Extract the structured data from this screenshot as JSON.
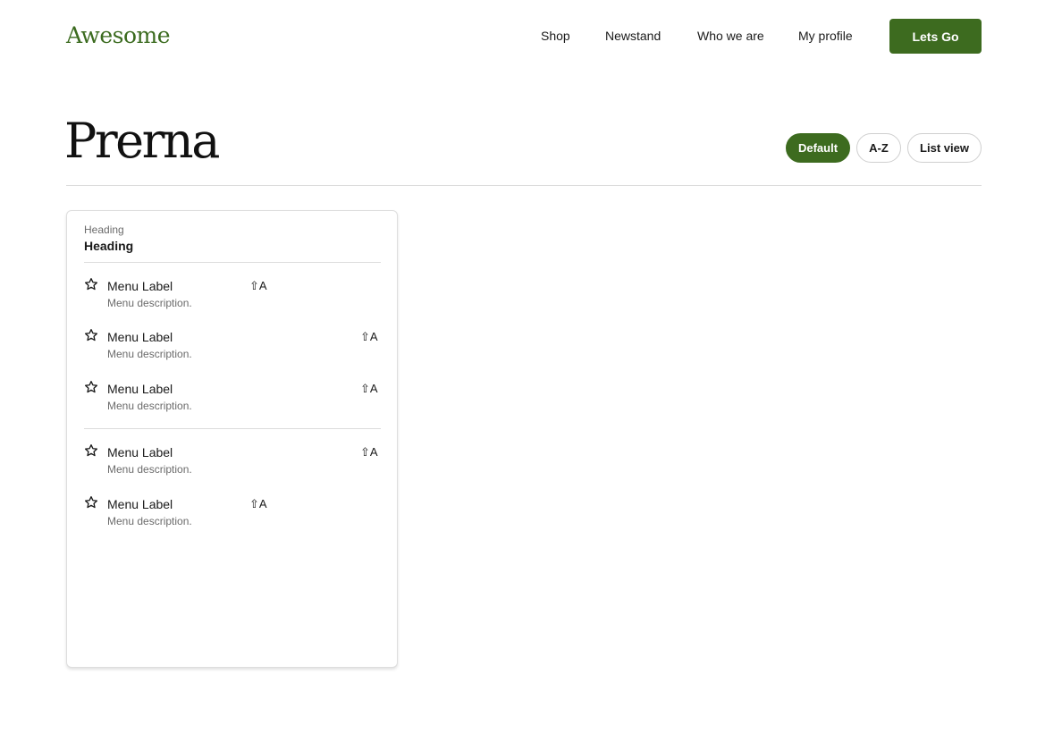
{
  "header": {
    "logo": "Awesome",
    "nav": [
      "Shop",
      "Newstand",
      "Who we are",
      "My profile"
    ],
    "cta_label": "Lets Go"
  },
  "page": {
    "title": "Prerna",
    "view_options": [
      "Default",
      "A-Z",
      "List view"
    ],
    "active_view": "Default"
  },
  "card": {
    "subheading": "Heading",
    "heading": "Heading",
    "groups": [
      [
        {
          "label": "Menu Label",
          "description": "Menu description.",
          "shortcut": "⇧A",
          "icon": "star-icon"
        },
        {
          "label": "Menu Label",
          "description": "Menu description.",
          "shortcut": "⇧A",
          "icon": "star-icon"
        },
        {
          "label": "Menu Label",
          "description": "Menu description.",
          "shortcut": "⇧A",
          "icon": "star-icon"
        }
      ],
      [
        {
          "label": "Menu Label",
          "description": "Menu description.",
          "shortcut": "⇧A",
          "icon": "star-icon"
        },
        {
          "label": "Menu Label",
          "description": "Menu description.",
          "shortcut": "⇧A",
          "icon": "star-icon"
        }
      ]
    ]
  },
  "colors": {
    "brand": "#3d6b1f",
    "divider": "#dcdcdc",
    "muted_text": "#6b6b6b"
  }
}
